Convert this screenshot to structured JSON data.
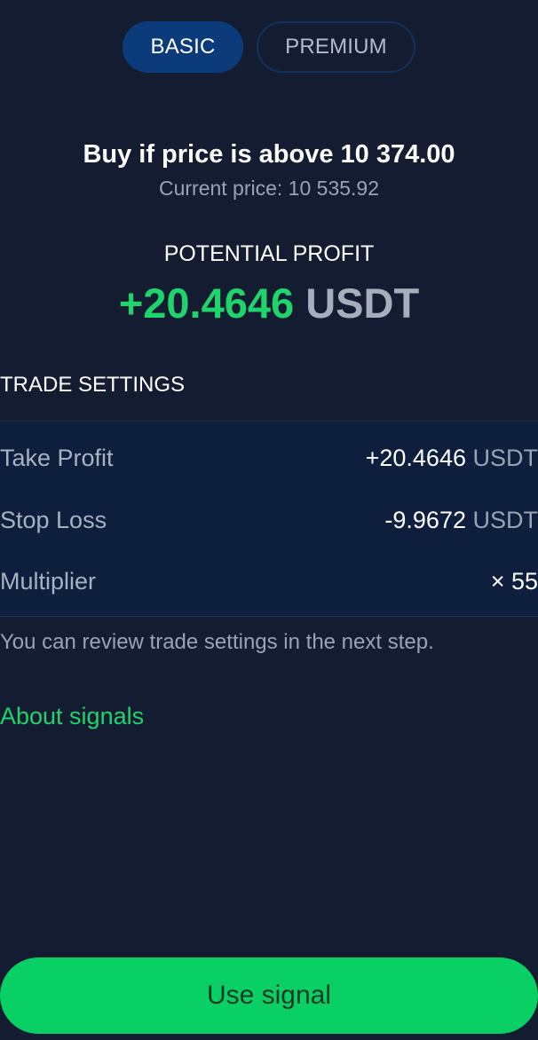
{
  "tabs": [
    {
      "label": "BASIC",
      "active": true
    },
    {
      "label": "PREMIUM",
      "active": false
    }
  ],
  "signal": {
    "condition": "Buy if price is above 10 374.00",
    "current_price": "Current price: 10 535.92"
  },
  "profit": {
    "label": "POTENTIAL PROFIT",
    "amount": "+20.4646",
    "unit": "USDT"
  },
  "trade_settings": {
    "title": "TRADE SETTINGS",
    "rows": [
      {
        "label": "Take Profit",
        "value": "+20.4646",
        "unit": "USDT"
      },
      {
        "label": "Stop Loss",
        "value": "-9.9672",
        "unit": "USDT"
      },
      {
        "label": "Multiplier",
        "value": "× 55",
        "unit": ""
      }
    ]
  },
  "hint": "You can review trade settings in the next step.",
  "about_link": "About signals",
  "cta_label": "Use signal",
  "colors": {
    "background": "#141c32",
    "accent_green": "#1fd46a",
    "button_green": "#09d065",
    "active_tab": "#0c3b7c",
    "panel": "#0d1f3d"
  }
}
